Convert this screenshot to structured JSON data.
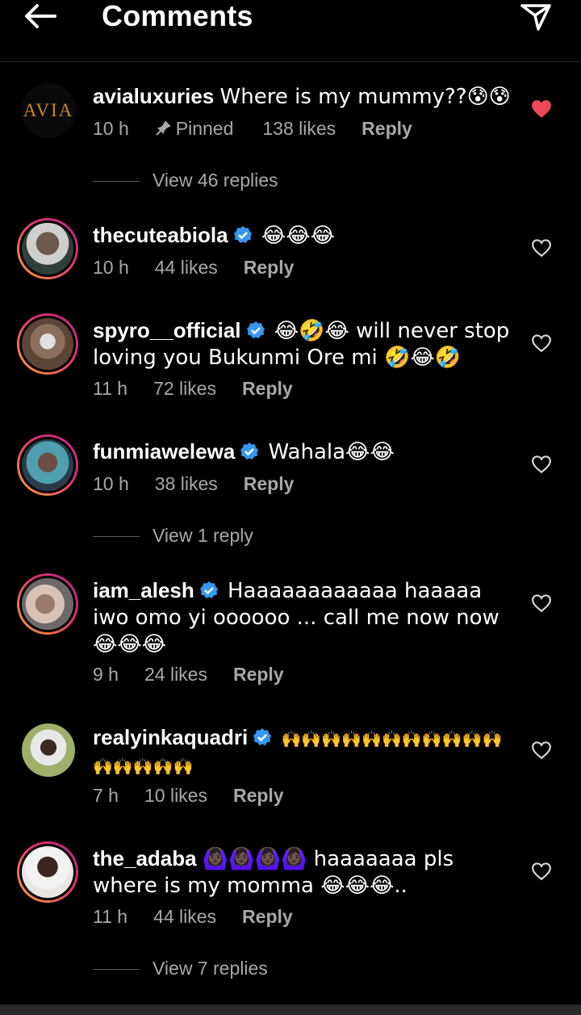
{
  "header": {
    "title": "Comments"
  },
  "comments": [
    {
      "user": "avialuxuries",
      "text": "Where is my mummy??😰😰",
      "time": "10 h",
      "pinned": "Pinned",
      "likes": "138 likes",
      "reply": "Reply",
      "liked": true,
      "avatar_text": "AVIA",
      "view_replies": "View 46 replies"
    },
    {
      "user": "thecuteabiola",
      "text": "😂😂😂",
      "time": "10 h",
      "likes": "44 likes",
      "reply": "Reply"
    },
    {
      "user": "spyro__official",
      "text": "😂🤣😂 will never stop loving you Bukunmi Ore mi 🤣😂🤣",
      "time": "11 h",
      "likes": "72 likes",
      "reply": "Reply"
    },
    {
      "user": "funmiawelewa",
      "text": "Wahala😂😂",
      "time": "10 h",
      "likes": "38 likes",
      "reply": "Reply",
      "view_replies": "View 1 reply"
    },
    {
      "user": "iam_alesh",
      "text": "Haaaaaaaaaaaa haaaaa iwo omo yi oooooo ... call me now now 😂😂😂",
      "time": "9 h",
      "likes": "24 likes",
      "reply": "Reply"
    },
    {
      "user": "realyinkaquadri",
      "text": "🙌🙌🙌🙌🙌🙌🙌🙌🙌🙌🙌🙌🙌🙌🙌🙌",
      "time": "7 h",
      "likes": "10 likes",
      "reply": "Reply"
    },
    {
      "user": "the_adaba",
      "text": "🙆🏿‍♀️🙆🏿‍♀️🙆🏿‍♀️🙆🏿‍♀️ haaaaaaa pls where is my momma 😂😂😂..",
      "time": "11 h",
      "likes": "44 likes",
      "reply": "Reply",
      "view_replies": "View 7 replies"
    }
  ],
  "colors": {
    "heart_liked": "#ed4956",
    "verified": "#3897f0",
    "muted": "#a8a8a8",
    "background": "#000000"
  }
}
